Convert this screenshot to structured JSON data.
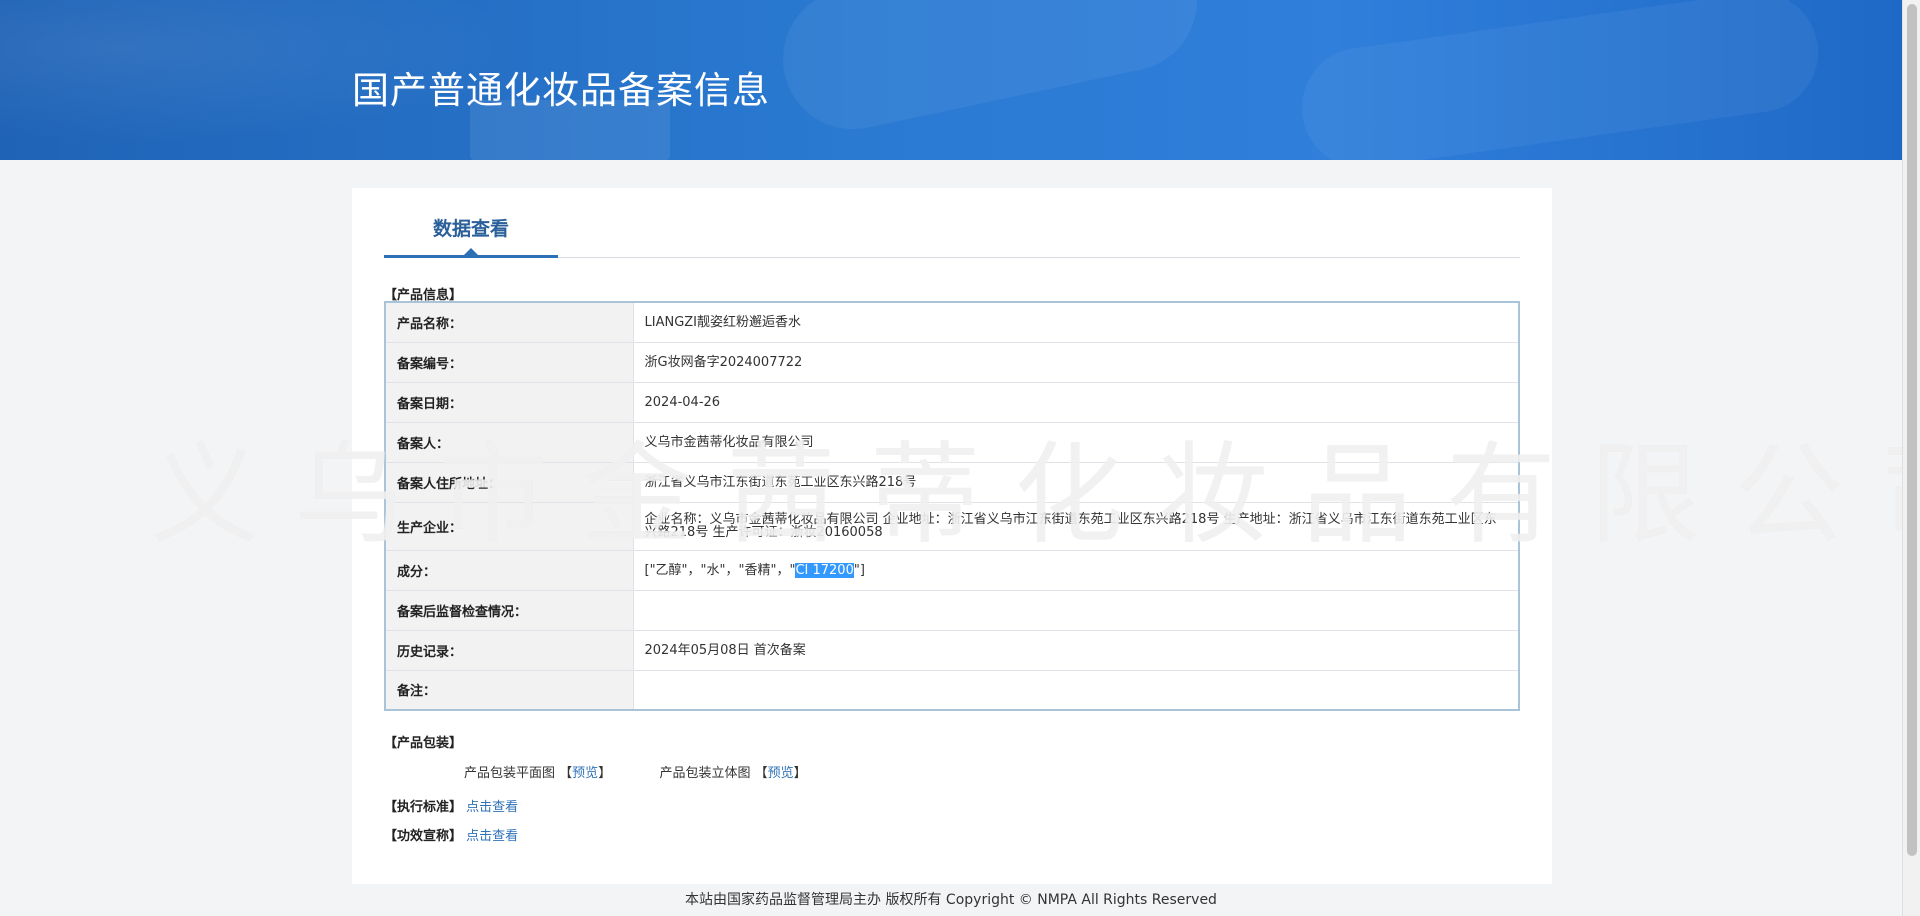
{
  "header": {
    "title": "国产普通化妆品备案信息"
  },
  "tabs": [
    {
      "label": "数据查看"
    }
  ],
  "product_info": {
    "section_label": "【产品信息】",
    "rows": [
      {
        "label": "产品名称：",
        "value": "LIANGZI靓姿红粉邂逅香水"
      },
      {
        "label": "备案编号：",
        "value": "浙G妆网备字2024007722"
      },
      {
        "label": "备案日期：",
        "value": "2024-04-26"
      },
      {
        "label": "备案人：",
        "value": "义乌市金茜蒂化妆品有限公司"
      },
      {
        "label": "备案人住所地址：",
        "value": "浙江省义乌市江东街道东苑工业区东兴路218号"
      },
      {
        "label": "生产企业：",
        "value": "企业名称：义乌市金茜蒂化妆品有限公司 企业地址：浙江省义乌市江东街道东苑工业区东兴路218号 生产地址：浙江省义乌市江东街道东苑工业区东兴路218号 生产许可证：浙妆20160058"
      },
      {
        "label": "成分：",
        "value_prefix": "[\"乙醇\"，\"水\"，\"香精\"，\"",
        "value_selected": "CI 17200",
        "value_suffix": "\"]"
      },
      {
        "label": "备案后监督检查情况：",
        "value": ""
      },
      {
        "label": "历史记录：",
        "value": "2024年05月08日 首次备案"
      },
      {
        "label": "备注：",
        "value": ""
      }
    ]
  },
  "packaging": {
    "section_label": "【产品包装】",
    "flat_label": "产品包装平面图",
    "solid_label": "产品包装立体图",
    "bracket_open": "【",
    "bracket_close": "】",
    "preview_link": "预览"
  },
  "standard": {
    "label": "【执行标准】",
    "link": "点击查看"
  },
  "efficacy": {
    "label": "【功效宣称】",
    "link": "点击查看"
  },
  "watermark": {
    "text": "义乌市金茜蒂化妆品有限公司"
  },
  "footer": {
    "text": "本站由国家药品监督管理局主办 版权所有 Copyright © NMPA All Rights Reserved"
  }
}
